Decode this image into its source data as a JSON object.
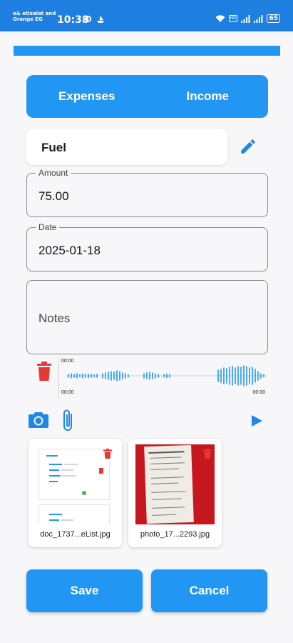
{
  "status_bar": {
    "carrier_line1": "e& etisalat and",
    "carrier_line2": "Orange EG",
    "time": "10:38",
    "hd_label": "HD",
    "battery": "65"
  },
  "tabs": [
    {
      "label": "Expenses"
    },
    {
      "label": "Income"
    }
  ],
  "title_field": {
    "value": "Fuel"
  },
  "amount_field": {
    "label": "Amount",
    "value": "75.00"
  },
  "date_field": {
    "label": "Date",
    "value": "2025-01-18"
  },
  "notes_field": {
    "placeholder": "Notes",
    "value": ""
  },
  "audio": {
    "time_top": "00:00",
    "time_start": "00:00",
    "time_end": "00:00"
  },
  "attachments": [
    {
      "file_name": "doc_1737...eList.jpg",
      "icon": "document-thumbnail"
    },
    {
      "file_name": "photo_17...2293.jpg",
      "icon": "receipt-photo"
    }
  ],
  "buttons": {
    "save": "Save",
    "cancel": "Cancel"
  },
  "colors": {
    "accent": "#2196f3",
    "status_bar": "#1e7fe0",
    "delete": "#e53935"
  }
}
